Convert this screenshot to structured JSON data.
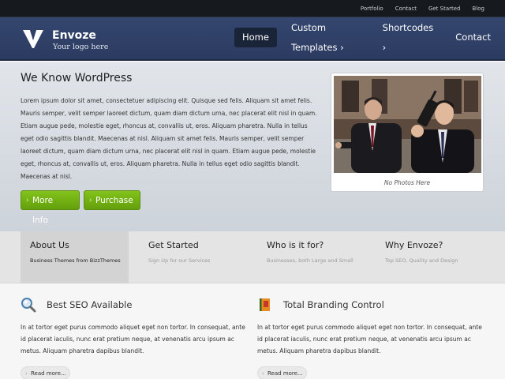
{
  "topnav": [
    "Portfolio",
    "Contact",
    "Get Started",
    "Blog"
  ],
  "logo": {
    "title": "Envoze",
    "tagline": "Your logo here"
  },
  "mainnav": [
    {
      "label": "Home",
      "active": true
    },
    {
      "label": "Custom Templates ›",
      "active": false
    },
    {
      "label": "Shortcodes ›",
      "active": false
    },
    {
      "label": "Contact",
      "active": false
    }
  ],
  "hero": {
    "title": "We Know WordPress",
    "text": "Lorem ipsum dolor sit amet, consectetuer adipiscing elit. Quisque sed felis. Aliquam sit amet felis. Mauris semper, velit semper laoreet dictum, quam diam dictum urna, nec placerat elit nisl in quam. Etiam augue pede, molestie eget, rhoncus at, convallis ut, eros. Aliquam pharetra. Nulla in tellus eget odio sagittis blandit. Maecenas at nisl. Aliquam sit amet felis. Mauris semper, velit semper laoreet dictum, quam diam dictum urna, nec placerat elit nisl in quam. Etiam augue pede, molestie eget, rhoncus at, convallis ut, eros. Aliquam pharetra. Nulla in tellus eget odio sagittis blandit. Maecenas at nisl.",
    "btn_more": "More Info",
    "btn_purchase": "Purchase",
    "photo_caption": "No Photos Here"
  },
  "strip": [
    {
      "title": "About Us",
      "sub": "Business Themes from BizzThemes",
      "active": true
    },
    {
      "title": "Get Started",
      "sub": "Sign Up for our Services",
      "active": false
    },
    {
      "title": "Who is it for?",
      "sub": "Businesses, both Large and Small",
      "active": false
    },
    {
      "title": "Why Envoze?",
      "sub": "Top SEO, Quality and Design",
      "active": false
    }
  ],
  "features": [
    {
      "icon": "magnifier-icon",
      "title": "Best SEO Available",
      "text": "In at tortor eget purus commodo aliquet eget non tortor. In consequat, ante id placerat iaculis, nunc erat pretium neque, at venenatis arcu ipsum ac metus. Aliquam pharetra dapibus blandit.",
      "readmore": "Read more..."
    },
    {
      "icon": "branding-book-icon",
      "title": "Total Branding Control",
      "text": "In at tortor eget purus commodo aliquet eget non tortor. In consequat, ante id placerat iaculis, nunc erat pretium neque, at venenatis arcu ipsum ac metus. Aliquam pharetra dapibus blandit.",
      "readmore": "Read more..."
    }
  ],
  "colors": {
    "accent_green": "#73b313",
    "header_blue": "#2f3f66",
    "topbar": "#16191d"
  }
}
